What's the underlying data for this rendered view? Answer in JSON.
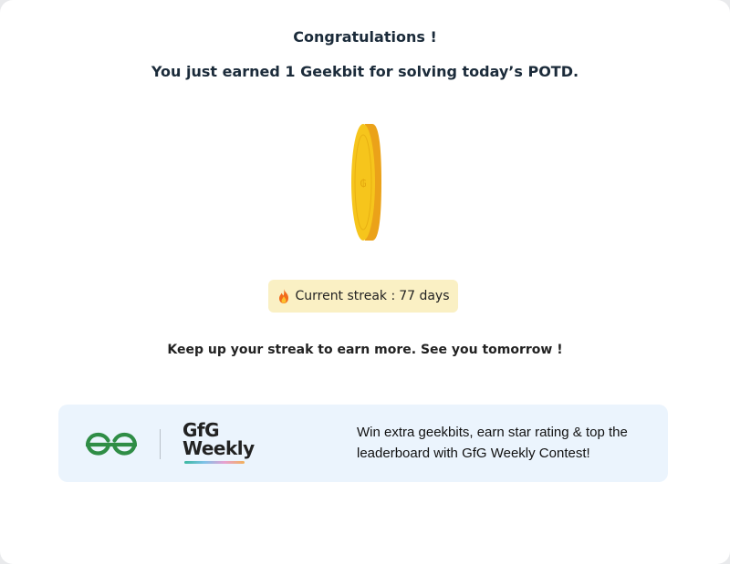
{
  "modal": {
    "title": "Congratulations !",
    "subtitle": "You just earned 1 Geekbit for solving today’s POTD."
  },
  "streak": {
    "label": "Current streak :",
    "value": "77 days",
    "icon": "fire-icon",
    "background": "#faf0c4"
  },
  "message": "Keep up your streak to earn more. See you tomorrow !",
  "banner": {
    "logo_text_line1": "GfG",
    "logo_text_line2": "Weekly",
    "text": "Win extra geekbits, earn star rating & top the leaderboard with GfG Weekly Contest!",
    "background": "#ebf4fd"
  },
  "colors": {
    "heading": "#1b2b3a",
    "coin": "#f5c518",
    "coin_edge": "#eba219",
    "brand_green": "#2f8d46"
  }
}
